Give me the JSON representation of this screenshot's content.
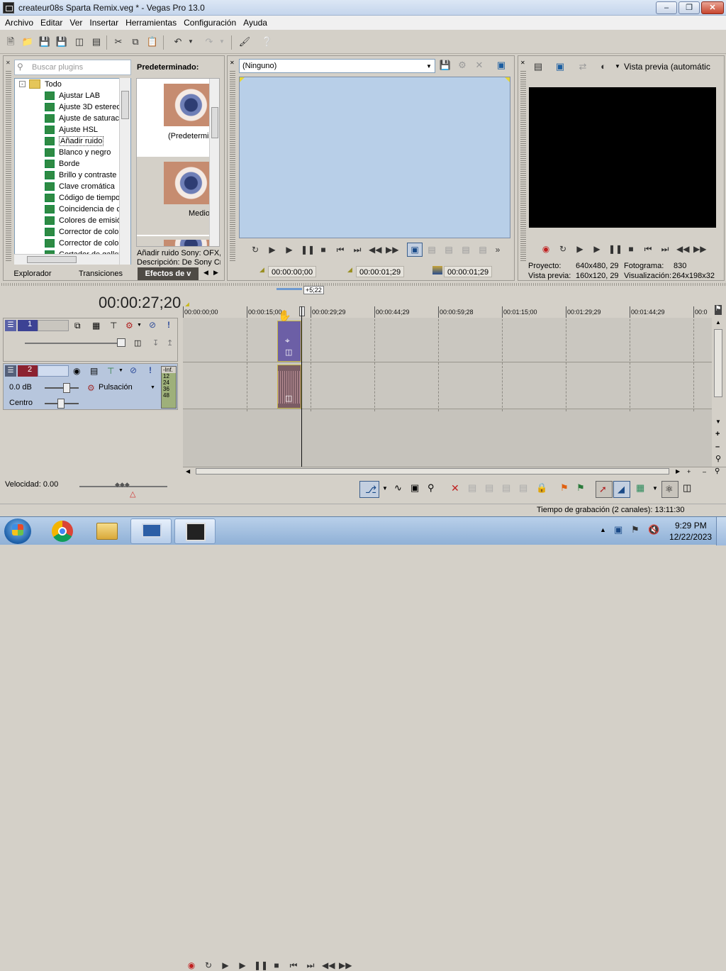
{
  "window": {
    "title": "createur08s Sparta Remix.veg * - Vegas Pro 13.0",
    "minimize_icon": "minimize-icon",
    "maximize_icon": "maximize-icon",
    "close_icon": "close-icon"
  },
  "menu": [
    "Archivo",
    "Editar",
    "Ver",
    "Insertar",
    "Herramientas",
    "Configuración",
    "Ayuda"
  ],
  "plugins": {
    "search_placeholder": "Buscar plugins",
    "root": "Todo",
    "items": [
      "Ajustar LAB",
      "Ajuste 3D estereo",
      "Ajuste de saturac",
      "Ajuste HSL",
      "Añadir ruido",
      "Blanco y negro",
      "Borde",
      "Brillo y contraste",
      "Clave cromática",
      "Código de tiempo",
      "Coincidencia de co",
      "Colores de emisión",
      "Corrector de color",
      "Corrector de color",
      "Cortador de gallet"
    ],
    "selected_index": 4,
    "presets_title": "Predeterminado:",
    "preset_1": "(Predetermi",
    "preset_2": "Medio",
    "desc_1": "Añadir ruido Sony: OFX,",
    "desc_2": "Descripción: De Sony Cre",
    "tabs": [
      "Explorador",
      "Transiciones",
      "Efectos de v"
    ]
  },
  "video_fx_preview": {
    "dropdown_value": "(Ninguno)",
    "tc_in": "00:00:00;00",
    "tc_out": "00:00:01;29",
    "tc_len": "00:00:01;29"
  },
  "main_preview": {
    "mode_label": "Vista previa (automátic",
    "proyecto_label": "Proyecto:",
    "proyecto_value": "640x480, 29",
    "fotograma_label": "Fotograma:",
    "fotograma_value": "830",
    "vista_label": "Vista previa:",
    "vista_value": "160x120, 29",
    "visualizacion_label": "Visualización:",
    "visualizacion_value": "264x198x32"
  },
  "timeline": {
    "current_time": "00:00:27;20",
    "loop_marker": "+5;22",
    "ruler_labels": [
      "00:00:00;00",
      "00:00:15;00",
      "00:00:29;29",
      "00:00:44;29",
      "00:00:59;28",
      "00:01:15;00",
      "00:01:29;29",
      "00:01:44;29",
      "00:0"
    ],
    "track1_number": "1",
    "track2_number": "2",
    "track2_volume": "0.0 dB",
    "track2_pan": "Centro",
    "track2_mode": "Pulsación",
    "meter_labels": [
      "-Inf.",
      "12",
      "24",
      "36",
      "48"
    ],
    "velocity": "Velocidad: 0.00"
  },
  "status": {
    "recording_time": "Tiempo de grabación (2 canales): 13:11:30"
  },
  "taskbar": {
    "time": "9:29 PM",
    "date": "12/22/2023"
  },
  "colors": {
    "preview_bg": "#b8cfe8",
    "video_clip": "#6c5fa6",
    "audio_clip": "#7a5c64",
    "track1_header": "#5b63a8",
    "track2_header": "#b7c6dd"
  }
}
